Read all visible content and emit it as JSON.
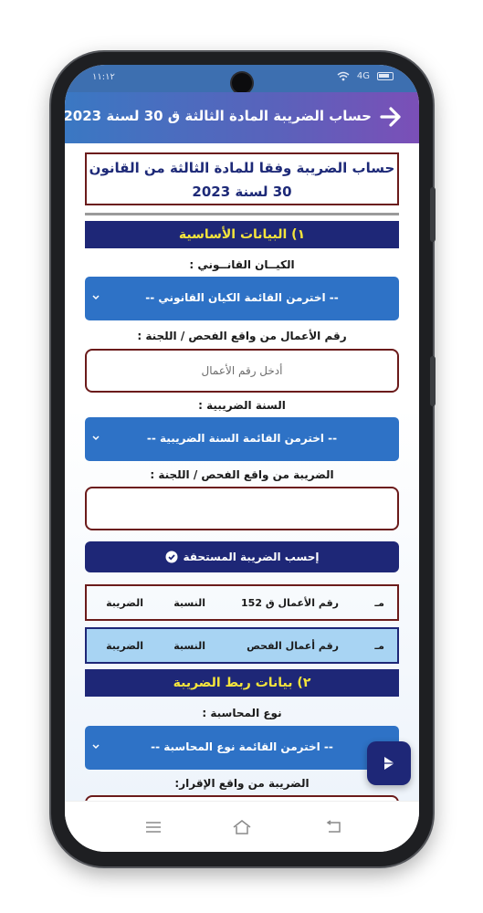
{
  "status_bar": {
    "time": "١١:١٢",
    "network": "4G"
  },
  "app_bar": {
    "title": "حساب الضريبة المادة الثالثة ق 30 لسنة 2023",
    "back_icon": "arrow-right-icon"
  },
  "header": {
    "line1": "حساب الضريبة وفقا للمادة الثالثة من القانون",
    "line2": "30 لسنة 2023"
  },
  "section1": {
    "title": "١) البيانات الأساسية"
  },
  "legal_entity": {
    "label": "الكيــان القانــوني :",
    "value": "-- اخترمن القائمة الكيان القانوني --"
  },
  "business_number": {
    "label": "رقم الأعمال من واقع الفحص / اللجنة :",
    "placeholder": "أدخل رقم الأعمال"
  },
  "tax_year": {
    "label": "السنة الضريبية :",
    "value": "-- اخترمن القائمة السنة الضريبية --"
  },
  "tax_from_exam": {
    "label": "الضريبة من واقع الفحص / اللجنة :",
    "value": ""
  },
  "calculate_button": {
    "label": "إحسب الضريبة المستحقة"
  },
  "results_table": {
    "row1": {
      "index": "مـ",
      "business": "رقم الأعمال ق 152",
      "ratio": "النسبة",
      "tax": "الضريبة"
    },
    "row2": {
      "index": "مـ",
      "business": "رقم أعمال الفحص",
      "ratio": "النسبة",
      "tax": "الضريبة"
    }
  },
  "section2": {
    "title": "٢) بيانات ربط الضريبة"
  },
  "accounting_type": {
    "label": "نوع المحاسبة :",
    "value": "-- اخترمن القائمة نوع المحاسبة --"
  },
  "tax_from_declaration": {
    "label": "الضريبة من واقع الإقرار:"
  },
  "colors": {
    "navy": "#1e2777",
    "blue": "#2e72c6",
    "border": "#6b1b1b",
    "yellow": "#f4e53c",
    "light_blue": "#a8d4f3"
  }
}
